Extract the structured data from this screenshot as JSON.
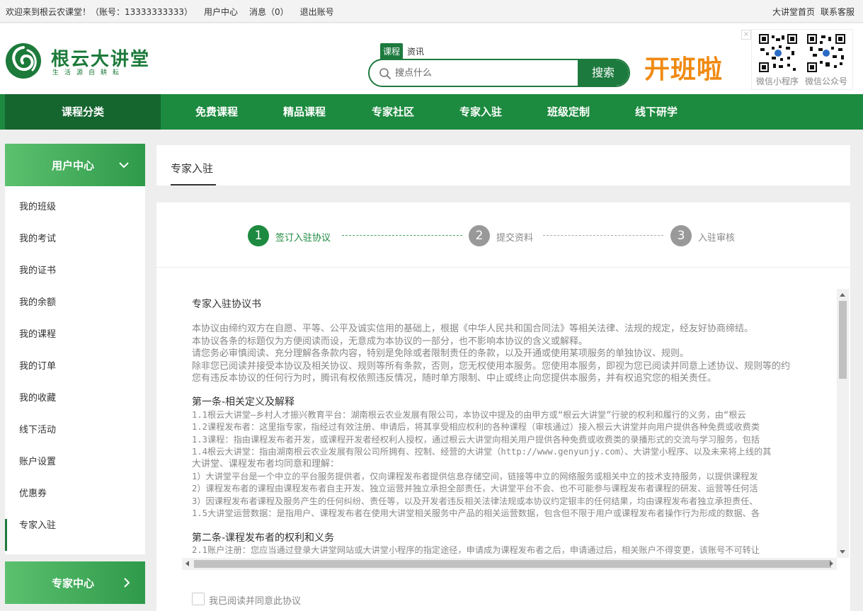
{
  "topbar": {
    "welcome": "欢迎来到根云农课堂！",
    "account": "（账号：13333333333）",
    "user_center": "用户中心",
    "messages": "消息（0）",
    "logout": "退出账号",
    "home": "大讲堂首页",
    "contact": "联系客服"
  },
  "logo": {
    "name": "根云大讲堂",
    "slogan": "生活源自耕耘"
  },
  "search": {
    "tabs": [
      "课程",
      "资讯"
    ],
    "active_tab": "课程",
    "placeholder": "搜点什么",
    "button": "搜索"
  },
  "banner": "开班啦",
  "qr": {
    "close": "×",
    "items": [
      {
        "label": "微信小程序",
        "icon": "qr-code-icon"
      },
      {
        "label": "微信公众号",
        "icon": "qr-code-icon"
      }
    ]
  },
  "nav": {
    "category": "课程分类",
    "items": [
      "免费课程",
      "精品课程",
      "专家社区",
      "专家入驻",
      "班级定制",
      "线下研学"
    ]
  },
  "sidebar": {
    "header": "用户中心",
    "items": [
      "我的班级",
      "我的考试",
      "我的证书",
      "我的余额",
      "我的课程",
      "我的订单",
      "我的收藏",
      "线下活动",
      "账户设置",
      "优惠券",
      "专家入驻"
    ],
    "active": "专家入驻",
    "footer": "专家中心"
  },
  "breadcrumb": {
    "title": "专家入驻"
  },
  "steps": [
    {
      "num": "1",
      "label": "签订入驻协议",
      "state": "active"
    },
    {
      "num": "2",
      "label": "提交资料",
      "state": "pending"
    },
    {
      "num": "3",
      "label": "入驻审核",
      "state": "pending"
    }
  ],
  "agreement": {
    "title": "专家入驻协议书",
    "paragraphs": [
      "本协议由缔约双方在自愿、平等、公平及诚实信用的基础上，根据《中华人民共和国合同法》等相关法律、法规的规定，经友好协商缔结。",
      "本协议各条的标题仅为方便阅读而设，无意成为本协议的一部分，也不影响本协议的含义或解释。",
      "请您务必审慎阅读、充分理解各条款内容，特别是免除或者限制责任的条款，以及开通或使用某项服务的单独协议、规则。",
      "除非您已阅读并接受本协议及相关协议、规则等所有条款，否则，您无权使用本服务。您使用本服务，即视为您已阅读并同意上述协议、规则等的约",
      "您有违反本协议的任何行为时，腾讯有权依照违反情况，随时单方限制、中止或终止向您提供本服务，并有权追究您的相关责任。"
    ],
    "section1_title": "第一条-相关定义及解释",
    "section1": [
      "1.1根云大讲堂—乡村人才振兴教育平台：湖南根云农业发展有限公司，本协议中提及的由甲方或“根云大讲堂”行驶的权利和履行的义务，由“根云",
      "1.2课程发布者：这里指专家，指经过有效注册、申请后，将其享受相应权利的各种课程（审核通过）接入根云大讲堂并向用户提供各种免费或收费类",
      "1.3课程：指由课程发布者开发，或课程开发者经权利人授权，通过根云大讲堂向相关用户提供各种免费或收费类的录播形式的交流与学习服务，包括",
      "1.4根云大讲堂：指由湖南根云农业发展有限公司所拥有、控制、经营的大讲堂（http://www.genyunjy.com）、大讲堂小程序、以及未来将上线的其",
      "大讲堂、课程发布者均同意和理解：",
      "1）大讲堂平台是一个中立的平台服务提供者，仅向课程发布者提供信息存储空间，链接等中立的网络服务或相关中立的技术支持服务，以提供课程发",
      "2）课程发布者的课程由课程发布者自主开发、独立运营并独立承担全部责任，大讲堂平台不会、也不可能参与课程发布者课程的研发、运营等任何活",
      "3）因课程发布者课程及服务产生的任何纠纷、责任等，以及开发者违反相关法律法规或本协议约定银丰的任何结果，均由课程发布者独立承担责任、",
      "1.5大讲堂运营数据：是指用户、课程发布者在使用大讲堂相关服务中产品的相关运营数据，包含但不限于用户或课程发布者操作行为形成的数据、各"
    ],
    "section2_title": "第二条-课程发布者的权利和义务",
    "section2": [
      "2.1账户注册：您应当通过登录大讲堂网站或大讲堂小程序的指定途径，申请成为课程发布者之后，申请通过后，相关账户不得变更，该账号不可转让"
    ]
  },
  "agree_label": "我已阅读并同意此协议",
  "colors": {
    "brand_green": "#1d7a3e",
    "nav_green": "#1c8a3f",
    "banner_orange": "#f08a12",
    "step_gray": "#999999"
  }
}
